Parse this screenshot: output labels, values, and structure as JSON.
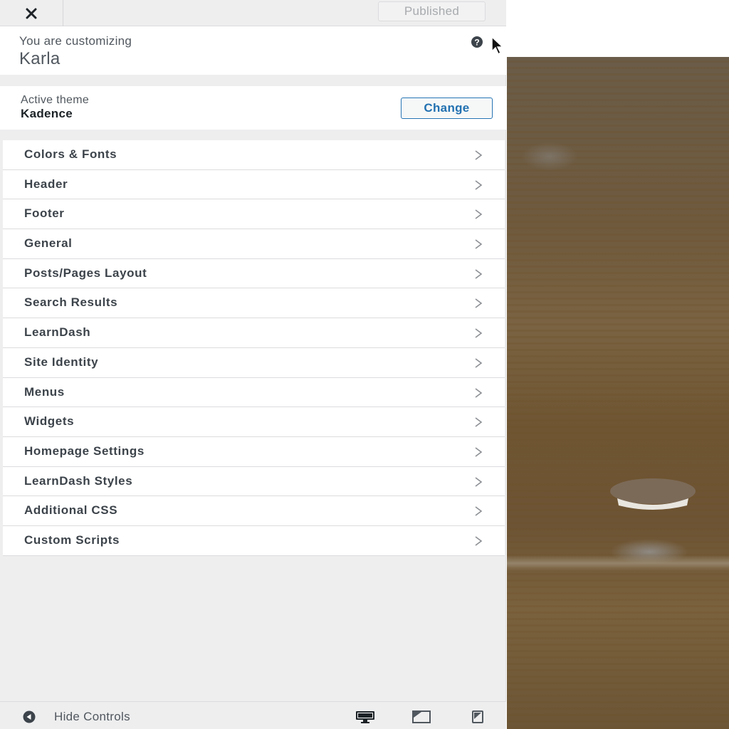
{
  "topbar": {
    "close_icon": "close-icon",
    "published_label": "Published"
  },
  "customizing": {
    "label": "You are customizing",
    "site_name": "Karla",
    "help_icon": "help-icon"
  },
  "theme": {
    "label": "Active theme",
    "name": "Kadence",
    "change_label": "Change"
  },
  "menu": {
    "items": [
      {
        "label": "Colors & Fonts"
      },
      {
        "label": "Header"
      },
      {
        "label": "Footer"
      },
      {
        "label": "General"
      },
      {
        "label": "Posts/Pages Layout"
      },
      {
        "label": "Search Results"
      },
      {
        "label": "LearnDash"
      },
      {
        "label": "Site Identity"
      },
      {
        "label": "Menus"
      },
      {
        "label": "Widgets"
      },
      {
        "label": "Homepage Settings"
      },
      {
        "label": "LearnDash Styles"
      },
      {
        "label": "Additional CSS"
      },
      {
        "label": "Custom Scripts"
      }
    ],
    "chevron_icon": "chevron-right-icon"
  },
  "footer": {
    "hide_controls_label": "Hide Controls",
    "devices": [
      "desktop-icon",
      "tablet-icon",
      "mobile-icon"
    ]
  },
  "colors": {
    "accent": "#2271b1",
    "sidebar_bg": "#eeeeef",
    "text": "#3c434a"
  }
}
